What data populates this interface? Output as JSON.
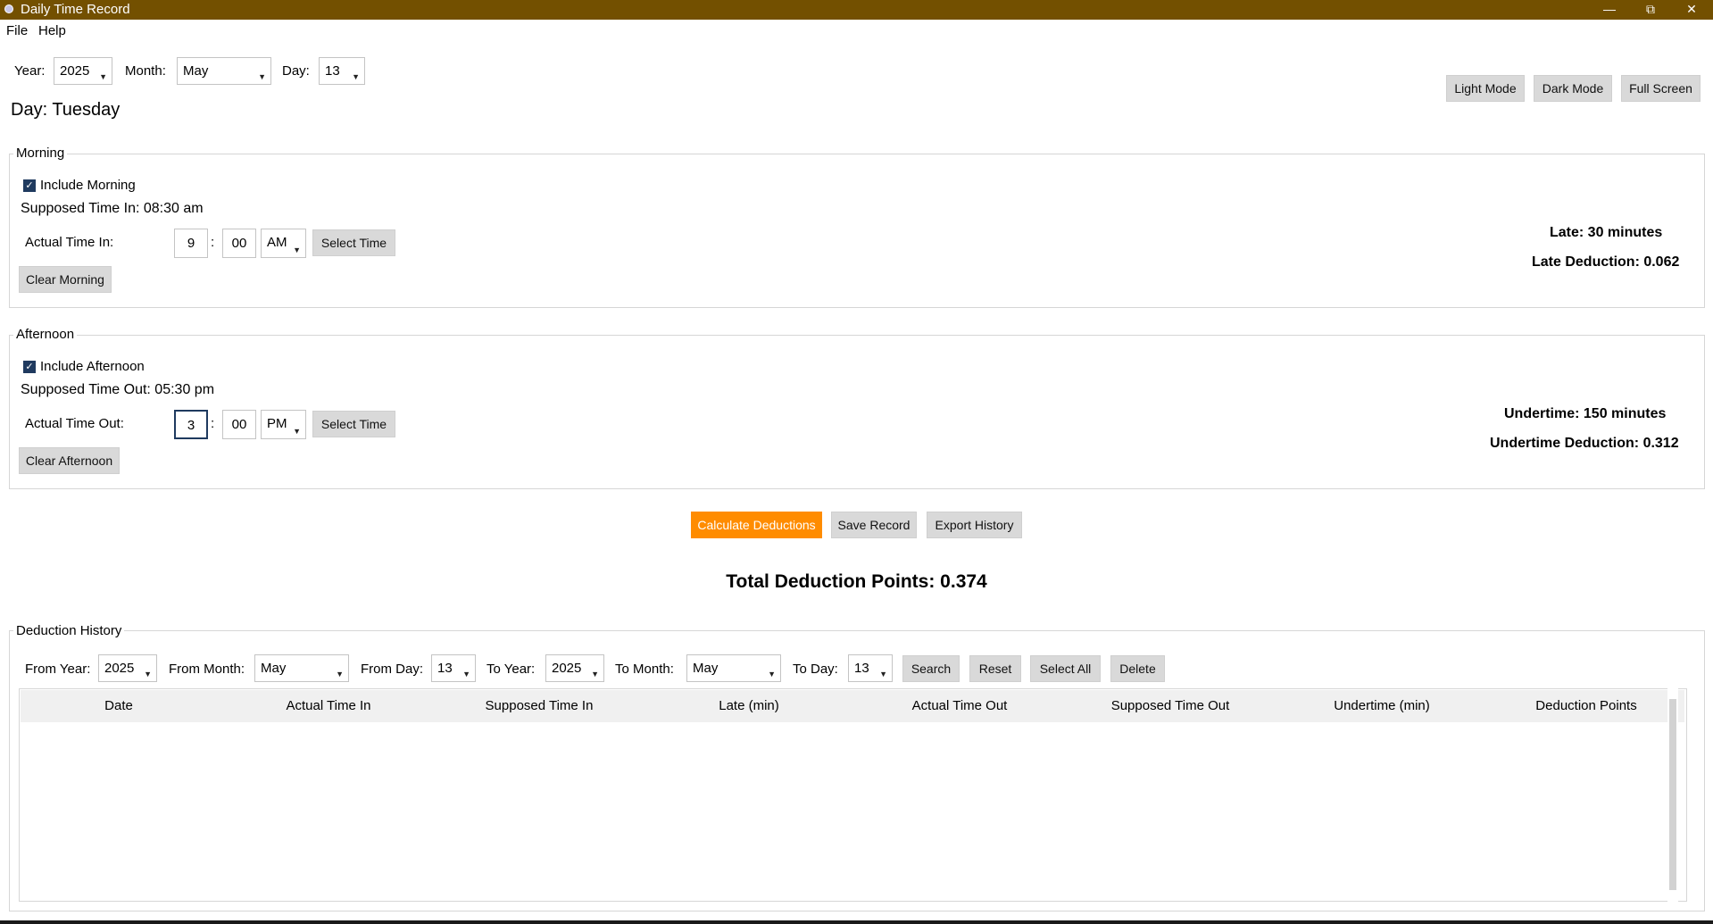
{
  "window": {
    "title": "Daily Time Record",
    "minimize": "—",
    "restore": "⧉",
    "close": "✕"
  },
  "menu": {
    "file": "File",
    "help": "Help"
  },
  "date": {
    "year_label": "Year:",
    "year": "2025",
    "month_label": "Month:",
    "month": "May",
    "day_label": "Day:",
    "day": "13",
    "day_name": "Day: Tuesday"
  },
  "view_buttons": {
    "light": "Light Mode",
    "dark": "Dark Mode",
    "full": "Full Screen"
  },
  "morning": {
    "legend": "Morning",
    "include_label": "Include Morning",
    "include_checked": true,
    "supposed": "Supposed Time In: 08:30 am",
    "actual_label": "Actual Time In:",
    "hour": "9",
    "sep": ":",
    "minute": "00",
    "ampm": "AM",
    "select_time": "Select Time",
    "clear": "Clear Morning",
    "late": "Late: 30 minutes",
    "late_deduction": "Late Deduction: 0.062"
  },
  "afternoon": {
    "legend": "Afternoon",
    "include_label": "Include Afternoon",
    "include_checked": true,
    "supposed": "Supposed Time Out: 05:30 pm",
    "actual_label": "Actual Time Out:",
    "hour": "3",
    "sep": ":",
    "minute": "00",
    "ampm": "PM",
    "select_time": "Select Time",
    "clear": "Clear Afternoon",
    "undertime": "Undertime: 150 minutes",
    "undertime_deduction": "Undertime Deduction: 0.312"
  },
  "actions": {
    "calculate": "Calculate Deductions",
    "save": "Save Record",
    "export": "Export History"
  },
  "total": "Total Deduction Points: 0.374",
  "history": {
    "legend": "Deduction History",
    "from_year_label": "From Year:",
    "from_year": "2025",
    "from_month_label": "From Month:",
    "from_month": "May",
    "from_day_label": "From Day:",
    "from_day": "13",
    "to_year_label": "To Year:",
    "to_year": "2025",
    "to_month_label": "To Month:",
    "to_month": "May",
    "to_day_label": "To Day:",
    "to_day": "13",
    "search": "Search",
    "reset": "Reset",
    "select_all": "Select All",
    "delete": "Delete",
    "columns": [
      "Date",
      "Actual Time In",
      "Supposed Time In",
      "Late (min)",
      "Actual Time Out",
      "Supposed Time Out",
      "Undertime (min)",
      "Deduction Points"
    ],
    "rows": []
  },
  "colors": {
    "titlebar": "#735000",
    "accent": "#ff8c00",
    "checkbox": "#1f3a5f"
  }
}
